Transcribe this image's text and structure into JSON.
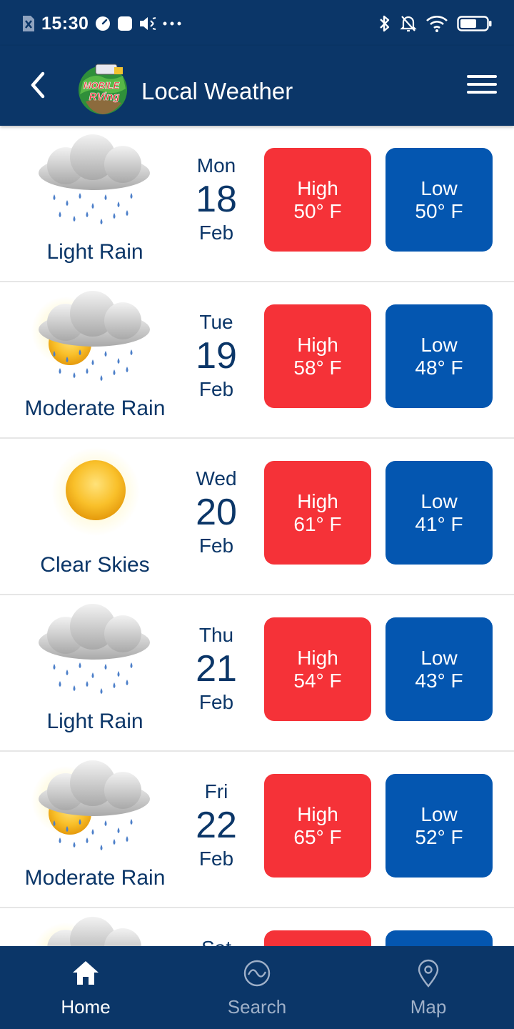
{
  "status_bar": {
    "time": "15:30",
    "left_icons": [
      "sim-icon",
      "clock-badge-icon",
      "square-notification-icon",
      "speaker-icon",
      "more-dots-icon"
    ],
    "right_icons": [
      "bluetooth-icon",
      "bell-muted-icon",
      "wifi-icon",
      "battery-icon"
    ]
  },
  "app_bar": {
    "title": "Local Weather",
    "logo_text": "MOBILE RVing"
  },
  "forecast": [
    {
      "icon": "light-rain-icon",
      "condition": "Light Rain",
      "dow": "Mon",
      "day": "18",
      "month": "Feb",
      "high_label": "High",
      "high": "50° F",
      "low_label": "Low",
      "low": "50° F"
    },
    {
      "icon": "moderate-rain-icon",
      "condition": "Moderate Rain",
      "dow": "Tue",
      "day": "19",
      "month": "Feb",
      "high_label": "High",
      "high": "58° F",
      "low_label": "Low",
      "low": "48° F"
    },
    {
      "icon": "clear-skies-icon",
      "condition": "Clear Skies",
      "dow": "Wed",
      "day": "20",
      "month": "Feb",
      "high_label": "High",
      "high": "61° F",
      "low_label": "Low",
      "low": "41° F"
    },
    {
      "icon": "light-rain-icon",
      "condition": "Light Rain",
      "dow": "Thu",
      "day": "21",
      "month": "Feb",
      "high_label": "High",
      "high": "54° F",
      "low_label": "Low",
      "low": "43° F"
    },
    {
      "icon": "moderate-rain-icon",
      "condition": "Moderate Rain",
      "dow": "Fri",
      "day": "22",
      "month": "Feb",
      "high_label": "High",
      "high": "65° F",
      "low_label": "Low",
      "low": "52° F"
    },
    {
      "icon": "partly-sunny-icon",
      "condition": "",
      "dow": "Sat",
      "day": "",
      "month": "",
      "high_label": "",
      "high": "",
      "low_label": "",
      "low": ""
    }
  ],
  "bottom_nav": {
    "items": [
      {
        "label": "Home",
        "icon": "home-icon",
        "active": true
      },
      {
        "label": "Search",
        "icon": "search-wave-icon",
        "active": false
      },
      {
        "label": "Map",
        "icon": "map-pin-icon",
        "active": false
      }
    ]
  },
  "colors": {
    "primary": "#0b3668",
    "high": "#f53238",
    "low": "#0456b0",
    "text": "#0b3668"
  }
}
